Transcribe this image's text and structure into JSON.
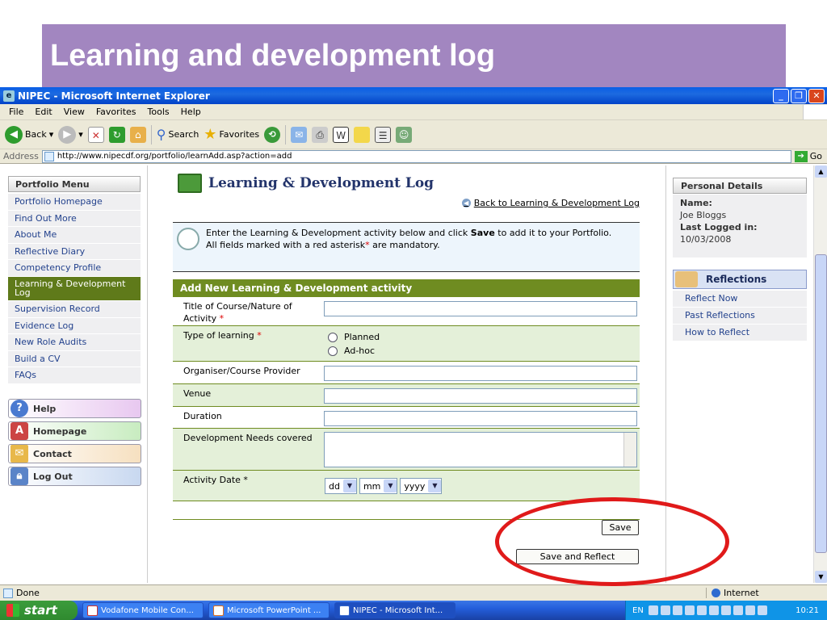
{
  "slide": {
    "title": "Learning and development log"
  },
  "browser": {
    "title": "NIPEC - Microsoft Internet Explorer",
    "menu": [
      "File",
      "Edit",
      "View",
      "Favorites",
      "Tools",
      "Help"
    ],
    "toolbar": {
      "back": "Back",
      "search": "Search",
      "favorites": "Favorites"
    },
    "address_label": "Address",
    "url": "http://www.nipecdf.org/portfolio/learnAdd.asp?action=add",
    "go": "Go",
    "status": "Done",
    "zone": "Internet"
  },
  "left_menu": {
    "heading": "Portfolio Menu",
    "items": [
      "Portfolio Homepage",
      "Find Out More",
      "About Me",
      "Reflective Diary",
      "Competency Profile",
      "Learning & Development Log",
      "Supervision Record",
      "Evidence Log",
      "New Role Audits",
      "Build a CV",
      "FAQs"
    ],
    "active_index": 5,
    "buttons": [
      "Help",
      "Homepage",
      "Contact",
      "Log Out"
    ]
  },
  "main": {
    "heading": "Learning & Development Log",
    "back_link": "Back to Learning & Development Log",
    "intro_1": "Enter the Learning & Development activity below and click",
    "intro_save": "Save",
    "intro_2": "to add it to your Portfolio.",
    "intro_3": "All fields marked with a red asterisk",
    "intro_star": "*",
    "intro_4": "are mandatory.",
    "form_heading": "Add New Learning & Development activity",
    "fields": {
      "title_label": "Title of Course/Nature of Activity",
      "type_label": "Type of learning",
      "type_options": [
        "Planned",
        "Ad-hoc"
      ],
      "organiser_label": "Organiser/Course Provider",
      "venue_label": "Venue",
      "duration_label": "Duration",
      "needs_label": "Development Needs covered",
      "date_label": "Activity Date *",
      "date_day": "dd",
      "date_month": "mm",
      "date_year": "yyyy",
      "required_star": "*"
    },
    "save": "Save",
    "save_reflect": "Save and Reflect"
  },
  "right_panel": {
    "heading": "Personal Details",
    "name_label": "Name:",
    "name": "Joe Bloggs",
    "last_logged_label": "Last Logged in:",
    "last_logged": "10/03/2008",
    "reflections_heading": "Reflections",
    "reflections_items": [
      "Reflect Now",
      "Past Reflections",
      "How to Reflect"
    ]
  },
  "taskbar": {
    "start": "start",
    "tasks": [
      "Vodafone Mobile Con...",
      "Microsoft PowerPoint ...",
      "NIPEC - Microsoft Int..."
    ],
    "lang": "EN",
    "clock": "10:21"
  },
  "colors": {
    "slide_banner": "#a286c0",
    "form_green": "#6f8c21",
    "highlight_oval": "#e01a1a",
    "link_blue": "#23428d"
  }
}
